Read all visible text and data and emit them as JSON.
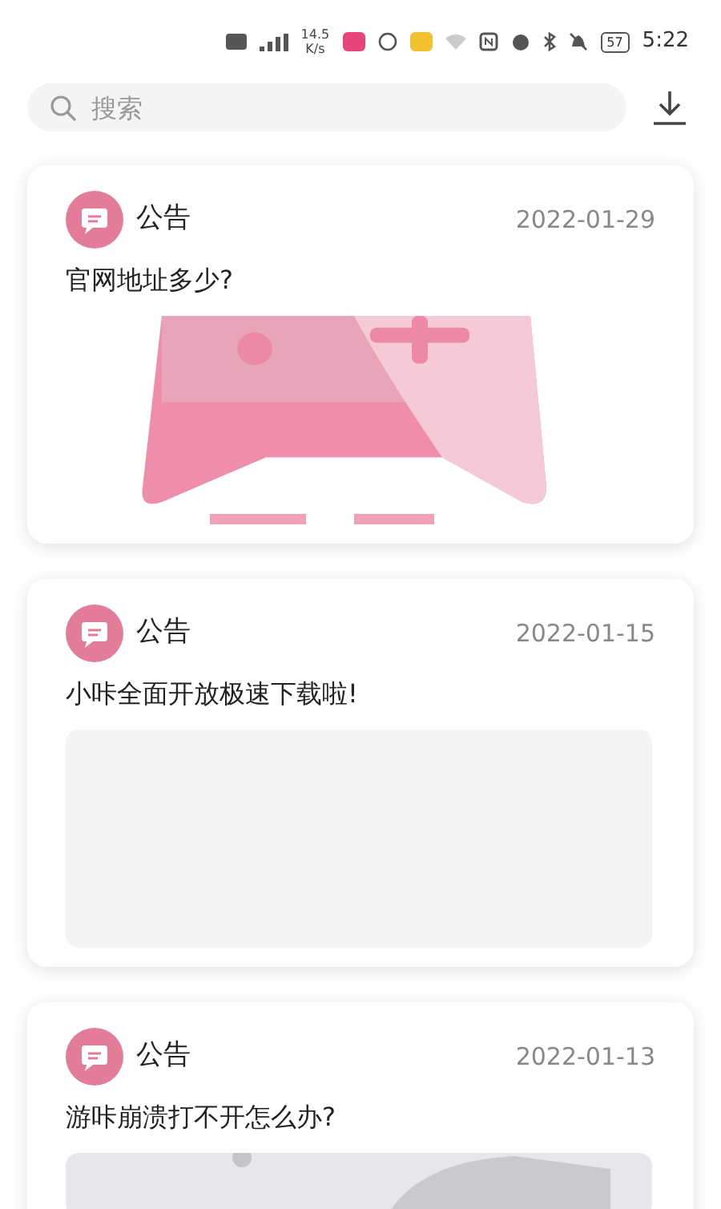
{
  "status_bar": {
    "network_speed": "14.5",
    "speed_unit": "K/s",
    "battery": "57",
    "time": "5:22"
  },
  "search": {
    "placeholder": "搜索"
  },
  "posts": [
    {
      "tag": "公告",
      "date": "2022-01-29",
      "title": "官网地址多少?"
    },
    {
      "tag": "公告",
      "date": "2022-01-15",
      "title": "小咔全面开放极速下载啦!"
    },
    {
      "tag": "公告",
      "date": "2022-01-13",
      "title": "游咔崩溃打不开怎么办?"
    }
  ]
}
